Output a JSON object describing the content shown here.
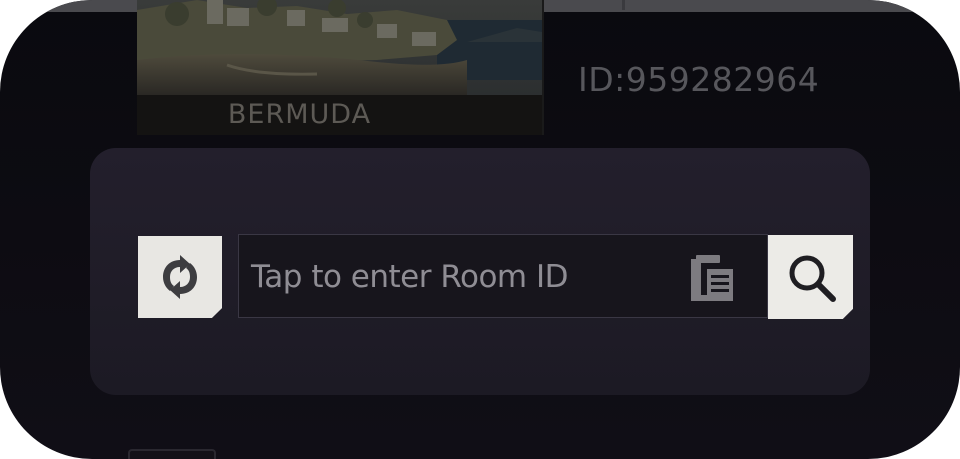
{
  "map": {
    "name": "BERMUDA"
  },
  "room": {
    "id_text": "ID:959282964"
  },
  "search": {
    "placeholder": "Tap to enter Room ID"
  },
  "icons": {
    "refresh": "refresh-icon",
    "paste": "clipboard-paste-icon",
    "search": "search-icon"
  },
  "colors": {
    "panel_bg": "#221e2b",
    "button_bg": "#e8e7e3",
    "text_muted": "#8f8d94"
  }
}
